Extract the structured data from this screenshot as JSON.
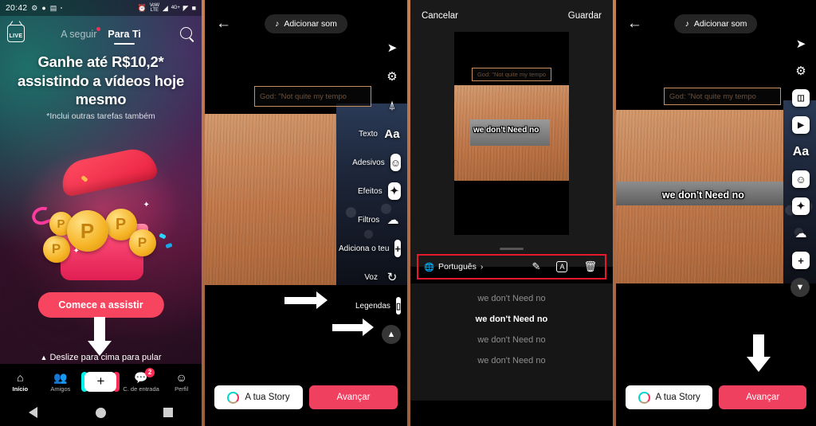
{
  "panel1": {
    "statusbar": {
      "time": "20:42",
      "icons": [
        "rotation-lock-icon",
        "dot-icon",
        "alarm-icon",
        "vowifi-icon",
        "wifi-icon",
        "4g-icon",
        "signal-icon",
        "battery-icon"
      ]
    },
    "topnav": {
      "live_label": "LIVE",
      "tabs": [
        {
          "label": "A seguir",
          "active": false,
          "dot": true
        },
        {
          "label": "Para Ti",
          "active": true,
          "dot": false
        }
      ],
      "search_icon": "search-icon"
    },
    "headline": "Ganhe até R$10,2* assistindo a vídeos hoje mesmo",
    "subnote": "*Inclui outras tarefas também",
    "cta_label": "Comece a assistir",
    "swipe_hint": "Deslize para cima para pular",
    "tabbar": [
      {
        "label": "Início",
        "icon": "home-icon",
        "active": true,
        "badge": ""
      },
      {
        "label": "Amigos",
        "icon": "friends-icon",
        "active": false,
        "badge": ""
      },
      {
        "label": "",
        "icon": "create-plus-icon",
        "active": false,
        "badge": ""
      },
      {
        "label": "C. de entrada",
        "icon": "inbox-icon",
        "active": false,
        "badge": "2"
      },
      {
        "label": "Perfil",
        "icon": "profile-icon",
        "active": false,
        "badge": ""
      }
    ],
    "navbar": [
      "back-nav-icon",
      "home-nav-icon",
      "recents-nav-icon"
    ]
  },
  "panel2": {
    "back_icon": "back-arrow-icon",
    "sound_label": "Adicionar som",
    "music_icon": "music-note-icon",
    "caption_preview": "God: \"Not quite my tempo",
    "rail": [
      {
        "label": "",
        "icon": "share-arrow-icon"
      },
      {
        "label": "",
        "icon": "adjust-gear-icon"
      },
      {
        "label": "",
        "icon": "download-icon"
      },
      {
        "label": "Texto",
        "icon": "text-aa-icon"
      },
      {
        "label": "Adesivos",
        "icon": "stickers-icon"
      },
      {
        "label": "Efeitos",
        "icon": "effects-icon"
      },
      {
        "label": "Filtros",
        "icon": "filters-icon"
      },
      {
        "label": "Adiciona o teu",
        "icon": "add-plus-icon"
      },
      {
        "label": "Voz",
        "icon": "voice-icon"
      },
      {
        "label": "Legendas",
        "icon": "captions-icon"
      }
    ],
    "collapse_icon": "chevron-up-icon",
    "story_label": "A tua Story",
    "next_label": "Avançar"
  },
  "panel3": {
    "cancel_label": "Cancelar",
    "save_label": "Guardar",
    "overlay_caption": "we don't Need no",
    "caption_preview": "God: \"Not quite my tempo",
    "language_label": "Português",
    "globe_icon": "globe-icon",
    "chevron_icon": "chevron-right-icon",
    "tools": [
      {
        "icon": "pencil-edit-icon"
      },
      {
        "icon": "font-style-icon"
      },
      {
        "icon": "trash-delete-icon"
      }
    ],
    "captions": [
      {
        "text": "we don't Need no",
        "active": false
      },
      {
        "text": "we don't Need no",
        "active": true
      },
      {
        "text": "we don't Need no",
        "active": false
      },
      {
        "text": "we don't Need no",
        "active": false
      }
    ]
  },
  "panel4": {
    "back_icon": "back-arrow-icon",
    "sound_label": "Adicionar som",
    "music_icon": "music-note-icon",
    "caption_preview": "God: \"Not quite my tempo",
    "overlay_caption": "we don't Need no",
    "rail": [
      {
        "icon": "share-arrow-icon"
      },
      {
        "icon": "adjust-gear-icon"
      },
      {
        "icon": "split-screen-icon"
      },
      {
        "icon": "video-cards-icon"
      },
      {
        "icon": "text-aa-icon"
      },
      {
        "icon": "stickers-icon"
      },
      {
        "icon": "effects-icon"
      },
      {
        "icon": "filters-icon"
      },
      {
        "icon": "add-plus-icon"
      }
    ],
    "collapse_icon": "chevron-down-icon",
    "story_label": "A tua Story",
    "next_label": "Avançar"
  },
  "colors": {
    "accent_red": "#fe2c55",
    "cta_red": "#f8455f",
    "next_red": "#ef4060",
    "highlight_red": "#e8172b",
    "caption_border": "#c98f5f"
  }
}
